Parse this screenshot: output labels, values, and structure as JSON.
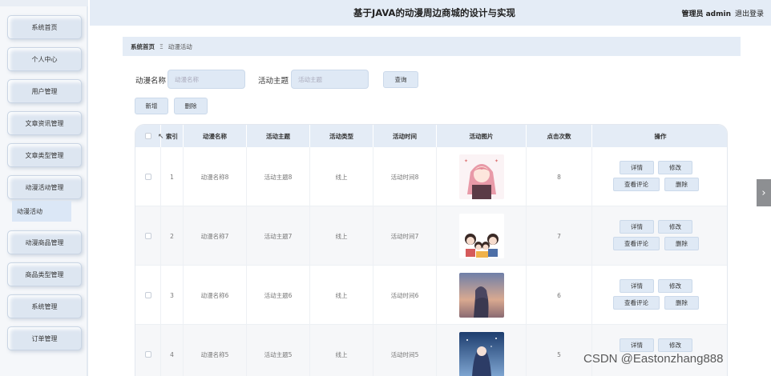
{
  "header": {
    "title": "基于JAVA的动漫周边商城的设计与实现",
    "user": "管理员 admin",
    "logout": "退出登录"
  },
  "sidebar": {
    "items": [
      {
        "label": "系统首页"
      },
      {
        "label": "个人中心"
      },
      {
        "label": "用户管理"
      },
      {
        "label": "文章资讯管理"
      },
      {
        "label": "文章类型管理"
      },
      {
        "label": "动漫活动管理"
      },
      {
        "label": "动漫商品管理"
      },
      {
        "label": "商品类型管理"
      },
      {
        "label": "系统管理"
      },
      {
        "label": "订单管理"
      }
    ],
    "active_sub": "动漫活动"
  },
  "breadcrumb": {
    "home": "系统首页",
    "separator": "Ξ",
    "current": "动漫活动"
  },
  "search": {
    "name_label": "动漫名称",
    "name_placeholder": "动漫名称",
    "theme_label": "活动主题",
    "theme_placeholder": "活动主题",
    "query_button": "查询"
  },
  "actions": {
    "add": "新增",
    "delete": "删除"
  },
  "table": {
    "headers": [
      "",
      "索引",
      "动漫名称",
      "活动主题",
      "活动类型",
      "活动时间",
      "活动图片",
      "点击次数",
      "操作"
    ],
    "rows": [
      {
        "index": "1",
        "name": "动漫名称8",
        "theme": "活动主题8",
        "type": "线上",
        "time": "活动时间8",
        "clicks": "8"
      },
      {
        "index": "2",
        "name": "动漫名称7",
        "theme": "活动主题7",
        "type": "线上",
        "time": "活动时间7",
        "clicks": "7"
      },
      {
        "index": "3",
        "name": "动漫名称6",
        "theme": "活动主题6",
        "type": "线上",
        "time": "活动时间6",
        "clicks": "6"
      },
      {
        "index": "4",
        "name": "动漫名称5",
        "theme": "活动主题5",
        "type": "线上",
        "time": "活动时间5",
        "clicks": "5"
      }
    ],
    "ops": {
      "detail": "详情",
      "edit": "修改",
      "comments": "查看评论",
      "delete": "删除"
    }
  },
  "watermark": "CSDN @Eastonzhang888",
  "icons": {
    "side_arrow": "chevron-right-icon"
  }
}
